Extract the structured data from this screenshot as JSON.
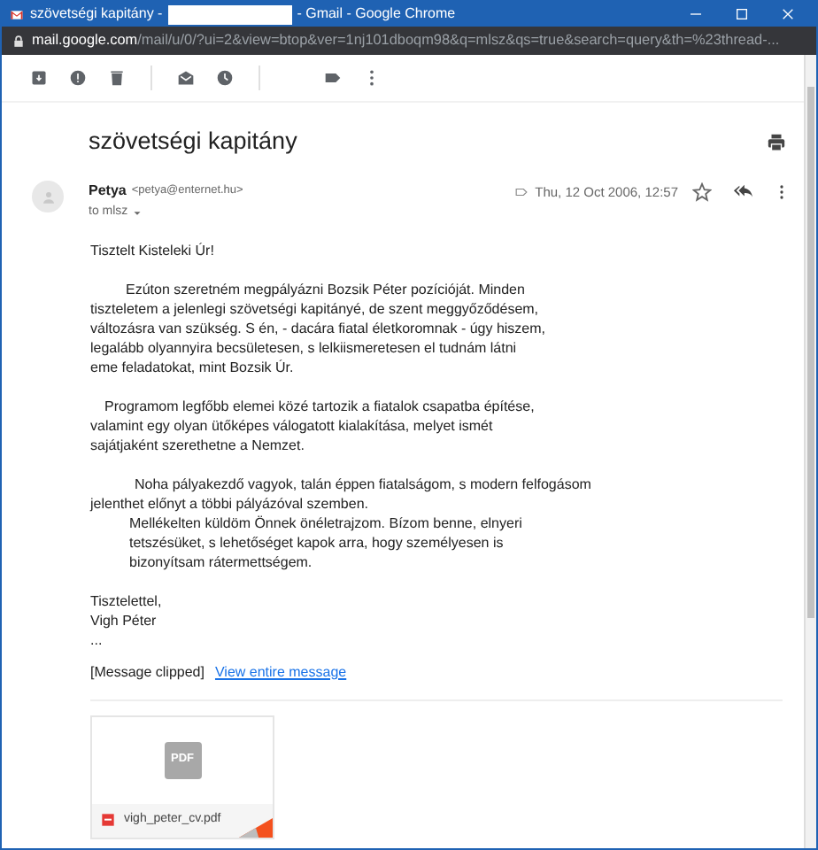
{
  "window": {
    "title_start": "szövetségi kapitány -",
    "title_end": "- Gmail - Google Chrome",
    "redacted": true
  },
  "address_bar": {
    "host": "mail.google.com",
    "path": "/mail/u/0/?ui=2&view=btop&ver=1nj101dboqm98&q=mlsz&qs=true&search=query&th=%23thread-..."
  },
  "subject": "szövetségi kapitány",
  "message": {
    "sender": "Petya",
    "email": "<petya@enternet.hu>",
    "date": "Thu, 12 Oct 2006, 12:57",
    "starred": false,
    "recipients": "to mlsz",
    "paragraphs": [
      [
        {
          "text": "Tisztelt Kisteleki Úr!",
          "kind": "plain"
        }
      ],
      [
        {
          "text": "Ezúton szeretném megpályázni Bozsik Péter pozícióját. Minden",
          "kind": "tab"
        },
        {
          "text": "tiszteletem a jelenlegi szövetségi kapitányé, de szent meggyőződésem,",
          "kind": "plain"
        },
        {
          "text": "változásra van szükség. S én, - dacára fiatal életkoromnak - úgy hiszem,",
          "kind": "plain"
        },
        {
          "text": "legalább olyannyira becsületesen, s lelkiismeretesen el tudnám látni",
          "kind": "plain"
        },
        {
          "text": "eme feladatokat, mint Bozsik Úr.",
          "kind": "plain"
        }
      ],
      [
        {
          "text": "Programom legfőbb elemei közé tartozik a fiatalok csapatba építése,",
          "kind": "space"
        },
        {
          "text": "valamint egy olyan ütőképes válogatott kialakítása, melyet ismét",
          "kind": "plain"
        },
        {
          "text": "sajátjaként szerethetne a Nemzet.",
          "kind": "plain"
        }
      ],
      [
        {
          "text": "Noha pályakezdő vagyok, talán éppen fiatalságom, s modern felfogásom",
          "kind": "wide"
        },
        {
          "text": "jelenthet előnyt a többi pályázóval szemben.",
          "kind": "plain"
        },
        {
          "text": "Mellékelten küldöm Önnek önéletrajzom. Bízom benne, elnyeri",
          "kind": "block"
        },
        {
          "text": "tetszésüket, s lehetőséget kapok arra, hogy személyesen is",
          "kind": "block"
        },
        {
          "text": "bizonyítsam rátermettségem.",
          "kind": "block"
        }
      ],
      [
        {
          "text": "Tisztelettel,",
          "kind": "plain"
        },
        {
          "text": "Vigh Péter",
          "kind": "plain"
        },
        {
          "text": "...",
          "kind": "plain"
        }
      ]
    ],
    "clipped_note": "[Message clipped]",
    "clipped_link": "View entire message",
    "attachment": {
      "preview_label": "PDF",
      "filename": "vigh_peter_cv.pdf"
    }
  }
}
